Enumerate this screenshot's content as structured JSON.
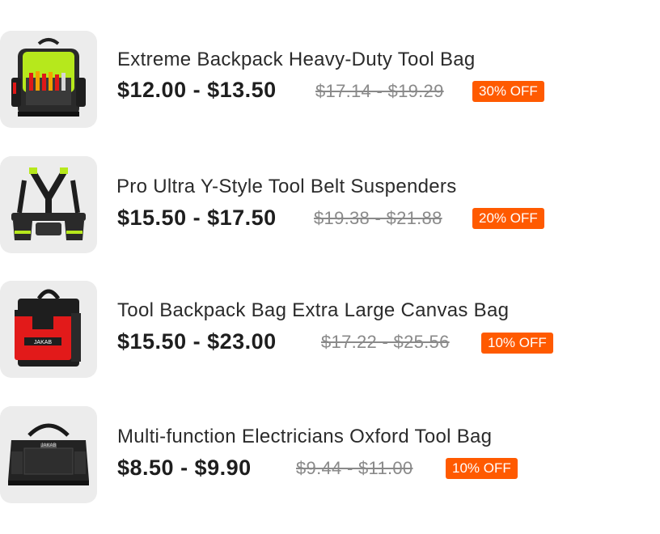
{
  "products": [
    {
      "title": "Extreme Backpack Heavy-Duty Tool Bag",
      "price": "$12.00 - $13.50",
      "original_price": "$17.14 - $19.29",
      "discount": "30% OFF",
      "image_icon": "green-backpack-image"
    },
    {
      "title": "Pro Ultra Y-Style Tool Belt Suspenders",
      "price": "$15.50 - $17.50",
      "original_price": "$19.38 - $21.88",
      "discount": "20% OFF",
      "image_icon": "tool-belt-suspenders-image"
    },
    {
      "title": "Tool Backpack Bag Extra Large Canvas Bag",
      "price": "$15.50 - $23.00",
      "original_price": "$17.22 - $25.56",
      "discount": "10% OFF",
      "image_icon": "red-canvas-bag-image"
    },
    {
      "title": "Multi-function Electricians Oxford Tool Bag",
      "price": "$8.50 - $9.90",
      "original_price": "$9.44 - $11.00",
      "discount": "10% OFF",
      "image_icon": "black-oxford-bag-image"
    }
  ],
  "colors": {
    "discount_badge": "#ff5a00",
    "thumbnail_bg": "#ececec",
    "accent_green": "#b6e81c",
    "accent_red": "#e21a1a"
  }
}
